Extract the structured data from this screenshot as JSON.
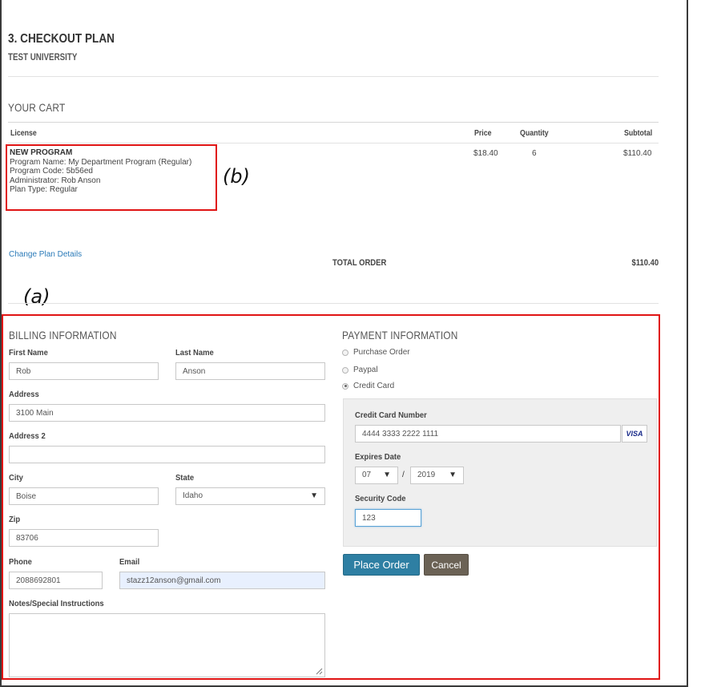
{
  "header": {
    "title": "3. CHECKOUT PLAN",
    "subtitle": "TEST UNIVERSITY"
  },
  "cart": {
    "heading": "YOUR CART",
    "columns": {
      "license": "License",
      "price": "Price",
      "quantity": "Quantity",
      "subtotal": "Subtotal"
    },
    "item": {
      "title": "NEW PROGRAM",
      "program_name": "Program Name: My Department Program (Regular)",
      "program_code": "Program Code: 5b56ed",
      "administrator": "Administrator: Rob Anson",
      "plan_type": "Plan Type: Regular",
      "price": "$18.40",
      "quantity": "6",
      "subtotal": "$110.40"
    },
    "change_link": "Change Plan Details",
    "total_label": "TOTAL ORDER",
    "total_value": "$110.40"
  },
  "annotations": {
    "a": "(a)",
    "b": "(b)",
    "box_color": "#e01414"
  },
  "billing": {
    "heading": "BILLING INFORMATION",
    "first_name_label": "First Name",
    "first_name_value": "Rob",
    "last_name_label": "Last Name",
    "last_name_value": "Anson",
    "address_label": "Address",
    "address_value": "3100 Main",
    "address2_label": "Address 2",
    "address2_value": "",
    "city_label": "City",
    "city_value": "Boise",
    "state_label": "State",
    "state_value": "Idaho",
    "zip_label": "Zip",
    "zip_value": "83706",
    "phone_label": "Phone",
    "phone_value": "2088692801",
    "email_label": "Email",
    "email_value": "stazz12anson@gmail.com",
    "notes_label": "Notes/Special Instructions",
    "notes_value": ""
  },
  "payment": {
    "heading": "PAYMENT INFORMATION",
    "options": [
      {
        "label": "Purchase Order",
        "selected": false
      },
      {
        "label": "Paypal",
        "selected": false
      },
      {
        "label": "Credit Card",
        "selected": true
      }
    ],
    "cc_number_label": "Credit Card Number",
    "cc_number_value": "4444 3333 2222 1111",
    "card_brand": "VISA",
    "expires_label": "Expires Date",
    "expires_month": "07",
    "expires_separator": "/",
    "expires_year": "2019",
    "security_label": "Security Code",
    "security_value": "123",
    "place_order_label": "Place Order",
    "cancel_label": "Cancel"
  },
  "colors": {
    "link": "#2a7ab8",
    "primary_button": "#2e7fa3",
    "secondary_button": "#6b6255",
    "email_autofill_bg": "#e8f0fe"
  }
}
